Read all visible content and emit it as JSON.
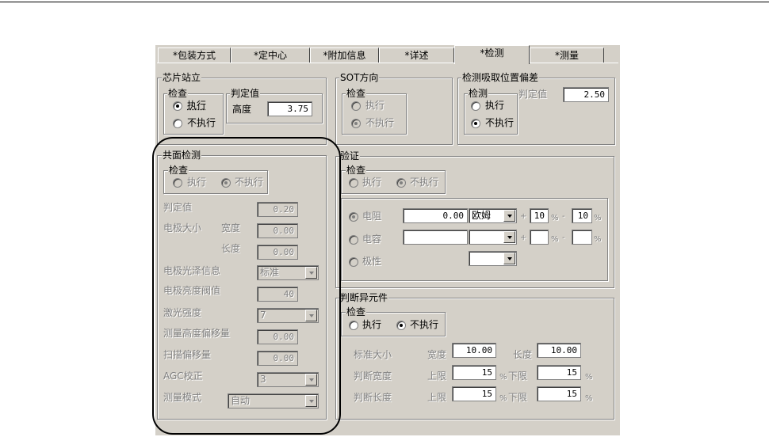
{
  "tabs": [
    "*包装方式",
    "*定中心",
    "*附加信息",
    "*详述",
    "*检测",
    "*测量"
  ],
  "chip_stand": {
    "title": "芯片站立",
    "check_title": "检查",
    "execute": "执行",
    "not_execute": "不执行",
    "judge_title": "判定值",
    "height_label": "高度",
    "height_value": "3.75"
  },
  "sot": {
    "title": "SOT方向",
    "check_title": "检查",
    "execute": "执行",
    "not_execute": "不执行"
  },
  "pickup": {
    "title": "检测吸取位置偏差",
    "check_title": "检测",
    "execute": "执行",
    "not_execute": "不执行",
    "judge_label": "判定值",
    "judge_value": "2.50"
  },
  "coplanar": {
    "title": "共面检测",
    "check_title": "检查",
    "execute": "执行",
    "not_execute": "不执行",
    "judge_label": "判定值",
    "judge_value": "0.20",
    "electrode_size": "电极大小",
    "width_label": "宽度",
    "width_value": "0.00",
    "length_label": "长度",
    "length_value": "0.00",
    "light_select": "电极光泽信息",
    "light_value": "标准",
    "brightness": "电极亮度阀值",
    "brightness_value": "40",
    "laser": "激光强度",
    "laser_value": "7",
    "height_offset": "测量高度偏移量",
    "height_offset_value": "0.00",
    "scan_offset": "扫描偏移量",
    "scan_offset_value": "0.00",
    "agc": "AGC校正",
    "agc_value": "3",
    "mode": "测量模式",
    "mode_value": "自动"
  },
  "verify": {
    "title": "验证",
    "check_title": "检查",
    "execute": "执行",
    "not_execute": "不执行",
    "resistance": "电阻",
    "resistance_value": "0.00",
    "resistance_unit": "欧姆",
    "plus": "+",
    "pct_plus": "10",
    "pct_sym1": "%",
    "minus": "-",
    "pct_minus": "10",
    "pct_sym2": "%",
    "capacitance": "电容",
    "polarity": "极性"
  },
  "abnormal": {
    "title": "判断异元件",
    "check_title": "检查",
    "execute": "执行",
    "not_execute": "不执行",
    "std_size": "标准大小",
    "width_label": "宽度",
    "width_value": "10.00",
    "length_label": "长度",
    "length_value": "10.00",
    "judge_width": "判断宽度",
    "judge_length": "判断长度",
    "upper": "上限",
    "lower": "下限",
    "w_upper": "15",
    "w_lower": "15",
    "l_upper": "15",
    "l_lower": "15",
    "pct": "%"
  }
}
